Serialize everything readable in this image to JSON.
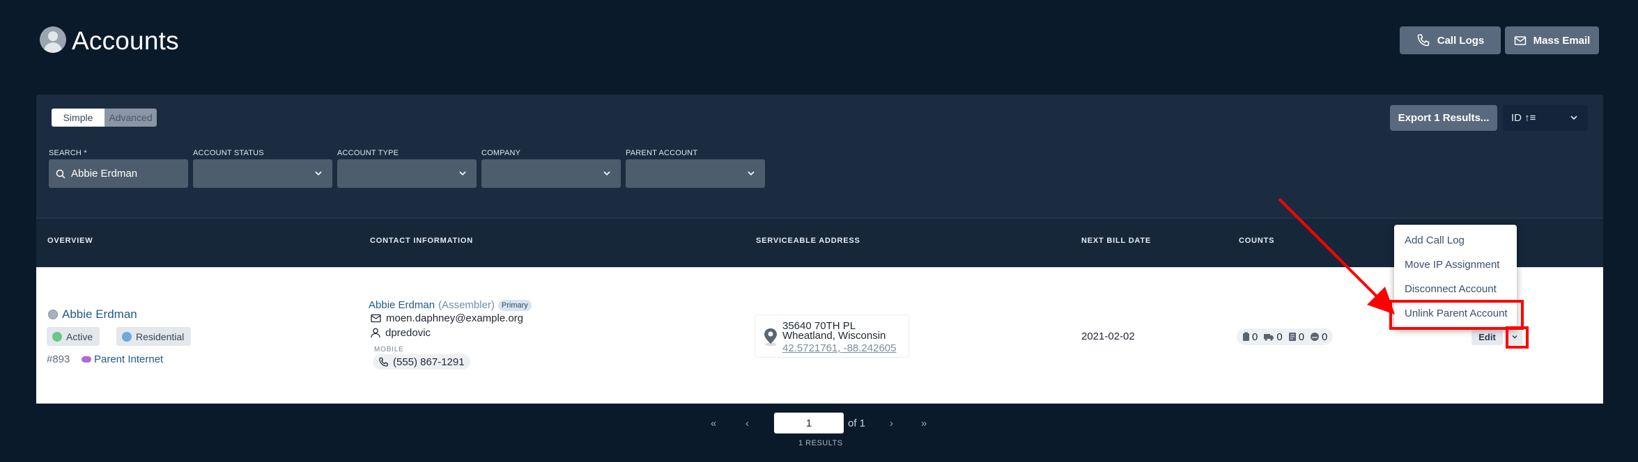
{
  "header": {
    "title": "Accounts",
    "call_logs_label": "Call Logs",
    "mass_email_label": "Mass Email"
  },
  "filters": {
    "mode_simple": "Simple",
    "mode_advanced": "Advanced",
    "export_label": "Export 1 Results...",
    "sort_label": "ID ↑≡",
    "search_label": "SEARCH *",
    "search_value": "Abbie Erdman",
    "account_status_label": "ACCOUNT STATUS",
    "account_type_label": "ACCOUNT TYPE",
    "company_label": "COMPANY",
    "parent_account_label": "PARENT ACCOUNT"
  },
  "table": {
    "columns": [
      "OVERVIEW",
      "CONTACT INFORMATION",
      "SERVICEABLE ADDRESS",
      "NEXT BILL DATE",
      "COUNTS"
    ],
    "row": {
      "name": "Abbie Erdman",
      "status": "Active",
      "status_color": "#6cc58a",
      "type": "Residential",
      "type_color": "#6ea8dc",
      "id": "#893",
      "parent": "Parent Internet",
      "contact_name": "Abbie Erdman",
      "contact_role": "(Assembler)",
      "contact_badge": "Primary",
      "email": "moen.daphney@example.org",
      "username": "dpredovic",
      "phone_label": "MOBILE",
      "phone": "(555) 867-1291",
      "address_line1": "35640 70TH PL",
      "address_line2": "Wheatland, Wisconsin",
      "coordinates": "42.5721761, -88.242605",
      "next_bill_date": "2021-02-02",
      "counts": [
        "0",
        "0",
        "0",
        "0"
      ],
      "edit_label": "Edit"
    }
  },
  "menu": {
    "items": [
      "Add Call Log",
      "Move IP Assignment",
      "Disconnect Account",
      "Unlink Parent Account"
    ]
  },
  "pagination": {
    "first": "«",
    "prev": "‹",
    "page": "1",
    "of": "of 1",
    "next": "›",
    "last": "»",
    "results": "1 RESULTS"
  },
  "colors": {
    "background": "#0b1a2a",
    "panel": "#1b2c40",
    "button": "#5a6a7e",
    "link": "#1f5a8a",
    "annotation": "#ff0000"
  }
}
